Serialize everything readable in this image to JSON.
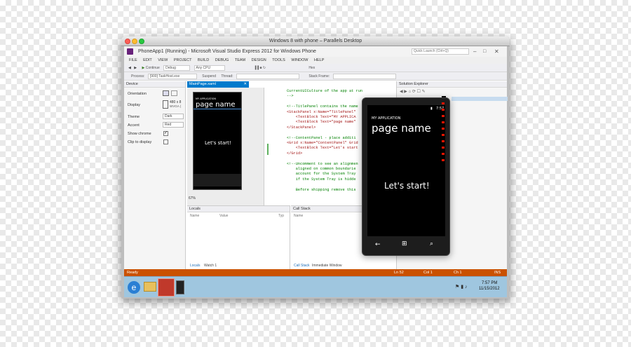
{
  "mac_window": {
    "title": "Windows 8 with phone – Parallels Desktop"
  },
  "vs": {
    "title": "PhoneApp1 (Running) - Microsoft Visual Studio Express 2012 for Windows Phone",
    "quick_launch": "Quick Launch (Ctrl+Q)",
    "menu": [
      "FILE",
      "EDIT",
      "VIEW",
      "PROJECT",
      "BUILD",
      "DEBUG",
      "TEAM",
      "DESIGN",
      "TOOLS",
      "WINDOW",
      "HELP"
    ],
    "toolbar": {
      "continue": "Continue",
      "config": "Debug",
      "platform": "Any CPU",
      "hex": "Hex"
    },
    "toolbar2": {
      "process_label": "Process:",
      "process_value": "[900] TaskHost.exe",
      "suspend": "Suspend",
      "thread_label": "Thread:",
      "stack_label": "Stack Frame:"
    },
    "device_panel": {
      "title": "Device",
      "orientation_label": "Orientation",
      "display_label": "Display",
      "display_value_1": "480 x 8",
      "display_value_2": "WVGA (",
      "theme_label": "Theme",
      "theme_value": "Dark",
      "accent_label": "Accent",
      "accent_value": "Red",
      "show_chrome_label": "Show chrome",
      "clip_label": "Clip to display"
    },
    "designer": {
      "tab": "MainPage.xaml",
      "app_title": "MY APPLICATION",
      "page_name": "page name",
      "content": "Let's start!",
      "zoom": "67%"
    },
    "code_lines": [
      {
        "text": "CurrentUICulture of the app at run time.",
        "cls": "c-g"
      },
      {
        "text": "-->",
        "cls": "c-g"
      },
      {
        "text": "",
        "cls": ""
      },
      {
        "text": "<!--TitlePanel contains the name",
        "cls": "c-g"
      },
      {
        "text": "<StackPanel x:Name=\"TitlePanel\"",
        "cls": "c-b"
      },
      {
        "text": "    <TextBlock Text=\"MY APPLICA",
        "cls": "c-b"
      },
      {
        "text": "    <TextBlock Text=\"page name\"",
        "cls": "c-b"
      },
      {
        "text": "</StackPanel>",
        "cls": "c-b"
      },
      {
        "text": "",
        "cls": ""
      },
      {
        "text": "<!--ContentPanel - place additi",
        "cls": "c-g"
      },
      {
        "text": "<Grid x:Name=\"ContentPanel\" Grid",
        "cls": "c-b"
      },
      {
        "text": "    <TextBlock Text=\"Let's start",
        "cls": "c-b"
      },
      {
        "text": "</Grid>",
        "cls": "c-b"
      },
      {
        "text": "",
        "cls": ""
      },
      {
        "text": "<!--Uncomment to see an alignmen",
        "cls": "c-g"
      },
      {
        "text": "    aligned on common boundarie",
        "cls": "c-g"
      },
      {
        "text": "    account for the System Tray",
        "cls": "c-g"
      },
      {
        "text": "    if the System Tray is hidde",
        "cls": "c-g"
      },
      {
        "text": "",
        "cls": ""
      },
      {
        "text": "    Before shipping remove this",
        "cls": "c-g"
      }
    ],
    "locals": {
      "title": "Locals",
      "col_name": "Name",
      "col_value": "Value",
      "col_type": "Typ",
      "tab1": "Locals",
      "tab2": "Watch 1"
    },
    "callstack": {
      "title": "Call Stack",
      "col_name": "Name",
      "tab1": "Call Stack",
      "tab2": "Immediate Window"
    },
    "solution_explorer": {
      "title": "Solution Explorer"
    },
    "status": {
      "ready": "Ready",
      "ln": "Ln 52",
      "col": "Col 1",
      "ch": "Ch 1",
      "ins": "INS"
    },
    "taskbar": {
      "time": "7:57 PM",
      "date": "11/15/2012"
    }
  },
  "emulator": {
    "clock": "7:57",
    "app_title": "MY APPLICATION",
    "page_name": "page name",
    "content": "Let's start!"
  },
  "colors": {
    "status_bar": "#ca5100",
    "accent_red": "#e51400",
    "taskbar": "#9fc6df"
  }
}
